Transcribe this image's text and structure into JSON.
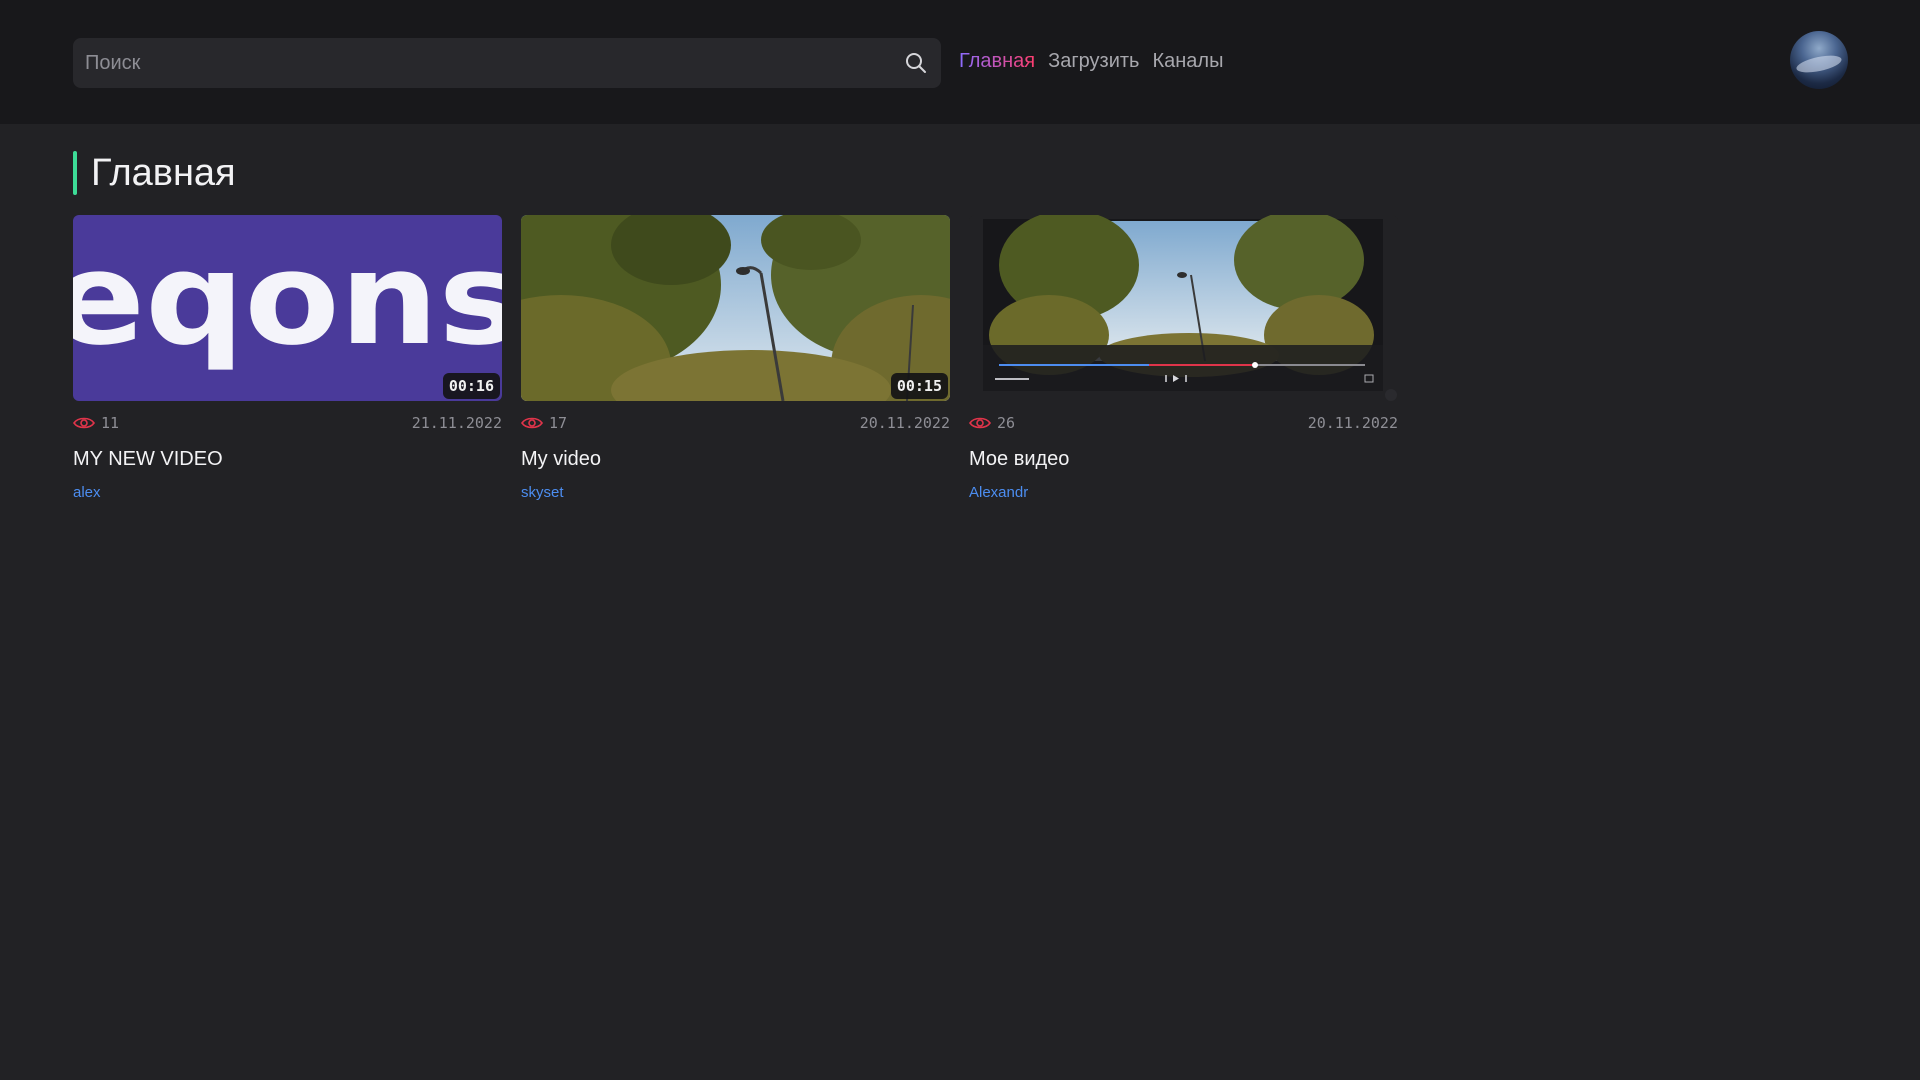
{
  "search": {
    "placeholder": "Поиск"
  },
  "nav": {
    "items": [
      {
        "label": "Главная",
        "active": true
      },
      {
        "label": "Загрузить",
        "active": false
      },
      {
        "label": "Каналы",
        "active": false
      }
    ]
  },
  "heading": {
    "title": "Главная",
    "accent_color": "#3ddc97"
  },
  "colors": {
    "background": "#222225",
    "topbar": "#18181b",
    "link": "#4c8df0",
    "views_icon": "#e0344a"
  },
  "videos": [
    {
      "title": "MY NEW VIDEO",
      "author": "alex",
      "views": "11",
      "date": "21.11.2022",
      "duration": "00:16",
      "thumbnail": "purple-logo-thumbnail",
      "thumbnail_text": "eqons"
    },
    {
      "title": "My video",
      "author": "skyset",
      "views": "17",
      "date": "20.11.2022",
      "duration": "00:15",
      "thumbnail": "trees-sky-thumbnail"
    },
    {
      "title": "Мое видео",
      "author": "Alexandr",
      "views": "26",
      "date": "20.11.2022",
      "duration": null,
      "thumbnail": "player-screenshot-thumbnail"
    }
  ]
}
